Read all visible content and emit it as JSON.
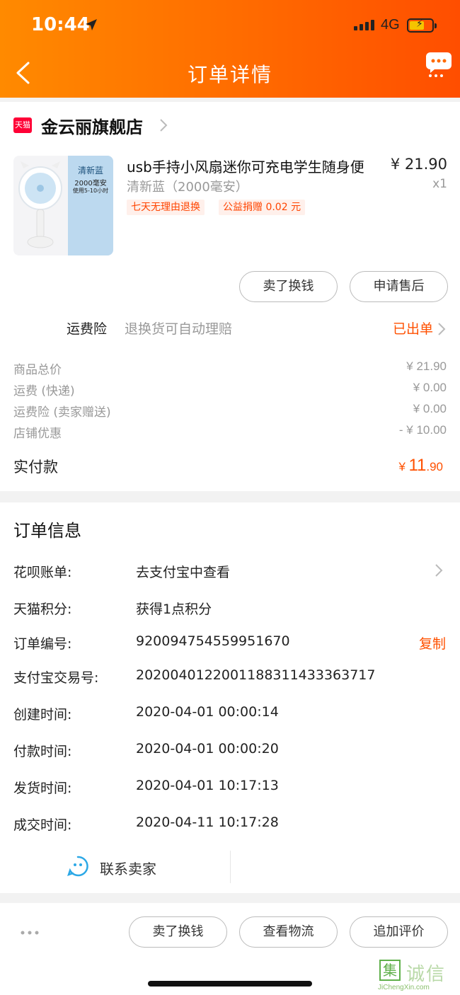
{
  "status_bar": {
    "time": "10:44",
    "network": "4G"
  },
  "header": {
    "title": "订单详情"
  },
  "store": {
    "badge": "天猫",
    "name": "金云丽旗舰店"
  },
  "product": {
    "title": "usb手持小风扇迷你可充电学生随身便",
    "price": "¥ 21.90",
    "spec": "清新蓝（2000毫安）",
    "qty": "x1",
    "tags": [
      "七天无理由退换",
      "公益捐赠 0.02 元"
    ],
    "image_text": {
      "color_name": "清新蓝",
      "capacity": "2000毫安",
      "usage": "使用5-10小时"
    }
  },
  "product_actions": {
    "sell": "卖了换钱",
    "after_sale": "申请售后"
  },
  "insurance": {
    "label": "运费险",
    "desc": "退换货可自动理赔",
    "status": "已出单"
  },
  "fees": [
    {
      "label": "商品总价",
      "value": "¥ 21.90"
    },
    {
      "label": "运费 (快递)",
      "value": "¥ 0.00"
    },
    {
      "label": "运费险 (卖家赠送)",
      "value": "¥ 0.00"
    },
    {
      "label": "店铺优惠",
      "value": "- ¥ 10.00"
    }
  ],
  "paid": {
    "label": "实付款",
    "currency": "¥",
    "integer": "11",
    "decimal": ".90"
  },
  "order_info": {
    "title": "订单信息",
    "rows": [
      {
        "label": "花呗账单:",
        "value": "去支付宝中查看"
      },
      {
        "label": "天猫积分:",
        "value": "获得1点积分"
      },
      {
        "label": "订单编号:",
        "value": "920094754559951670",
        "action": "复制"
      },
      {
        "label": "支付宝交易号:",
        "value": "2020040122001188311433363717"
      },
      {
        "label": "创建时间:",
        "value": "2020-04-01 00:00:14"
      },
      {
        "label": "付款时间:",
        "value": "2020-04-01 00:00:20"
      },
      {
        "label": "发货时间:",
        "value": "2020-04-01 10:17:13"
      },
      {
        "label": "成交时间:",
        "value": "2020-04-11 10:17:28"
      }
    ]
  },
  "contact": {
    "label": "联系卖家"
  },
  "bottom_actions": {
    "sell": "卖了换钱",
    "logistics": "查看物流",
    "review": "追加评价"
  },
  "watermark": {
    "logo_char": "集",
    "text": "诚信",
    "url": "JiChengXin.com"
  },
  "colors": {
    "accent": "#ff5000",
    "header_start": "#ff8a00",
    "header_end": "#ff4e00",
    "tmall": "#ff0036"
  }
}
